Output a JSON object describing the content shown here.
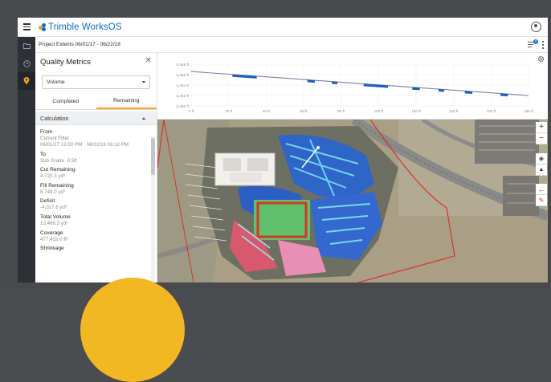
{
  "app": {
    "brand": "Trimble WorksOS",
    "brand_color": "#0f6bc6",
    "accent_color": "#f2a21c"
  },
  "header": {
    "menu_icon": "hamburger-menu-icon",
    "user_icon": "user-account-icon"
  },
  "rail": {
    "items": [
      {
        "icon": "folder-icon"
      },
      {
        "icon": "clock-icon"
      },
      {
        "icon": "location-pin-icon",
        "active": true
      }
    ]
  },
  "project_bar": {
    "label": "Project Extents",
    "dates": "06/01/17 - 06/22/18",
    "filter_badge": "1"
  },
  "panel": {
    "title": "Quality Metrics",
    "metric_select": "Volume",
    "tabs": [
      {
        "label": "Completed",
        "active": false
      },
      {
        "label": "Remaining",
        "active": true
      }
    ],
    "section_title": "Calculation",
    "rows": [
      {
        "label": "From",
        "value": "Current Filter",
        "value2": "06/01/17 12:00 PM - 06/22/18 03:12 PM"
      },
      {
        "label": "To",
        "value": "Sub Grade -0.5ft"
      },
      {
        "label": "Cut Remaining",
        "value": "4,720.3 yd³"
      },
      {
        "label": "Fill Remaining",
        "value": "8,748.0 yd³"
      },
      {
        "label": "Deficit",
        "value": "-4,027.6 yd³"
      },
      {
        "label": "Total Volume",
        "value": "13,468.3 yd³"
      },
      {
        "label": "Coverage",
        "value": "477,452.0 ft²"
      },
      {
        "label": "Shrinkage",
        "value": ""
      }
    ]
  },
  "chart_data": {
    "type": "line",
    "y_ticks": [
      "5,468 ft",
      "5,466 ft",
      "5,464 ft",
      "5,462 ft",
      "5,460 ft"
    ],
    "x_ticks": [
      "0 ft",
      "20 ft",
      "40 ft",
      "60 ft",
      "80 ft",
      "100 ft",
      "120 ft",
      "140 ft",
      "160 ft",
      "180 ft"
    ],
    "xlim": [
      0,
      180
    ],
    "ylim": [
      5460,
      5468
    ],
    "series": [
      {
        "x": [
          0,
          180
        ],
        "y": [
          5466.6,
          5462.0
        ]
      }
    ],
    "series_color": "#7a7fa8",
    "fill_color": "#1f5fb8"
  },
  "map_tools": [
    {
      "icon": "zoom-in-icon",
      "glyph": "+"
    },
    {
      "icon": "zoom-out-icon",
      "glyph": "−"
    },
    {
      "icon": "locate-icon",
      "glyph": "◈"
    },
    {
      "icon": "terrain-icon",
      "glyph": "▲"
    },
    {
      "icon": "back-arrow-icon",
      "glyph": "←"
    },
    {
      "icon": "draw-icon",
      "glyph": "✎"
    }
  ]
}
